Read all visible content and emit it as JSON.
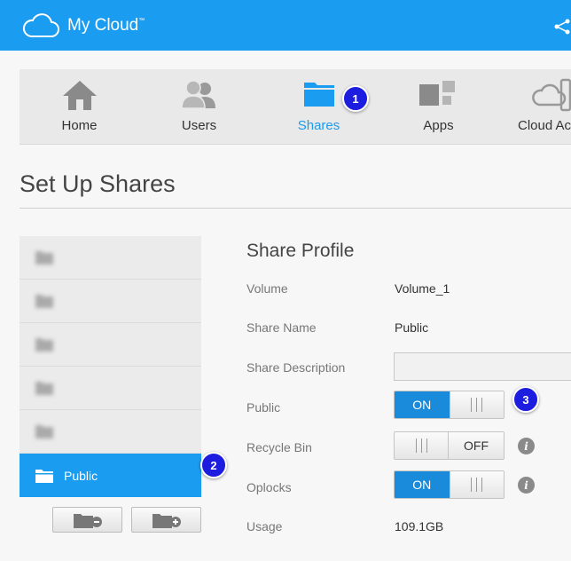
{
  "header": {
    "app_title": "My Cloud",
    "trademark": "™",
    "brand_color": "#1a9cf0"
  },
  "nav": {
    "items": [
      {
        "label": "Home",
        "icon": "home-icon"
      },
      {
        "label": "Users",
        "icon": "users-icon"
      },
      {
        "label": "Shares",
        "icon": "folder-icon",
        "active": true
      },
      {
        "label": "Apps",
        "icon": "apps-icon"
      },
      {
        "label": "Cloud Ac",
        "icon": "cloud-access-icon"
      }
    ]
  },
  "badges": [
    "1",
    "2",
    "3"
  ],
  "page": {
    "title": "Set Up Shares"
  },
  "share_list": {
    "selected_label": "Public",
    "blurred_count": 5
  },
  "profile": {
    "title": "Share Profile",
    "volume_label": "Volume",
    "volume_value": "Volume_1",
    "share_name_label": "Share Name",
    "share_name_value": "Public",
    "description_label": "Share Description",
    "description_value": "",
    "public_label": "Public",
    "public_state": "ON",
    "recycle_label": "Recycle Bin",
    "recycle_state": "OFF",
    "oplocks_label": "Oplocks",
    "oplocks_state": "ON",
    "usage_label": "Usage",
    "usage_value": "109.1GB"
  }
}
